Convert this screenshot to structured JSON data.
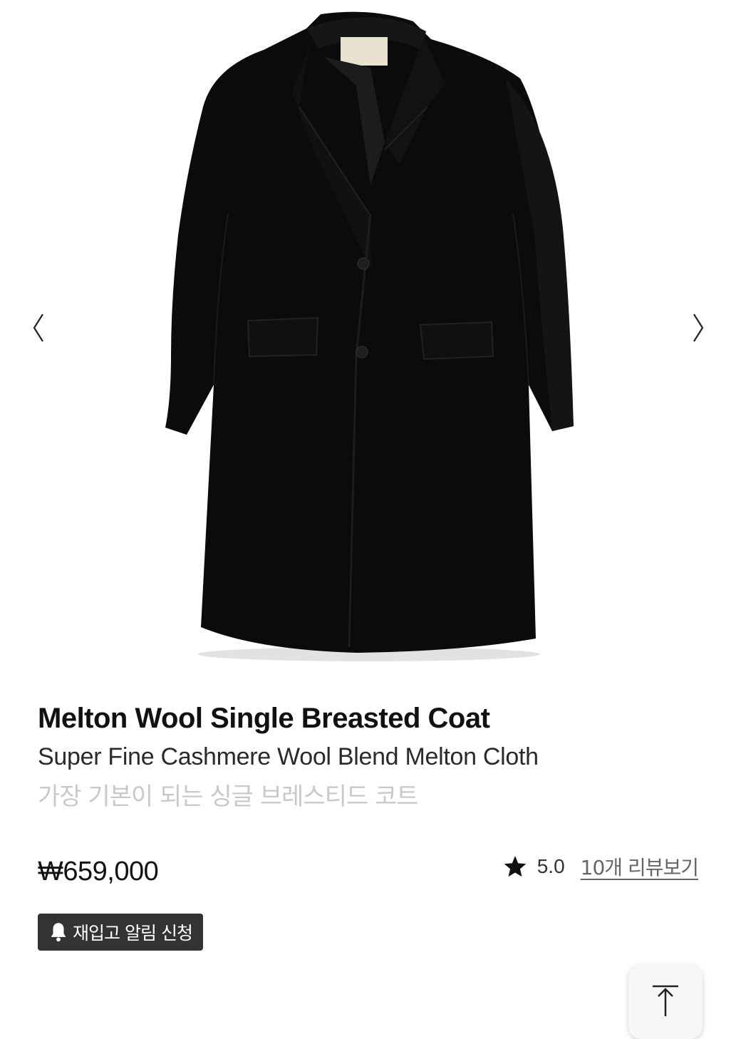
{
  "gallery": {
    "image_alt": "black single breasted coat",
    "prev_icon": "chevron-left-icon",
    "next_icon": "chevron-right-icon"
  },
  "product": {
    "title": "Melton Wool Single Breasted Coat",
    "subtitle": "Super Fine Cashmere Wool Blend Melton Cloth",
    "description": "가장 기본이 되는 싱글 브레스티드 코트",
    "price": "₩659,000"
  },
  "rating": {
    "icon": "star-icon",
    "value": "5.0",
    "reviews_link": "10개 리뷰보기"
  },
  "restock": {
    "icon": "bell-icon",
    "label": "재입고 알림 신청"
  },
  "scroll_top": {
    "icon": "arrow-up-to-top-icon"
  },
  "colors": {
    "coat": "#0b0b0b",
    "button_bg": "#333333",
    "muted_text": "#c9c9c9"
  }
}
